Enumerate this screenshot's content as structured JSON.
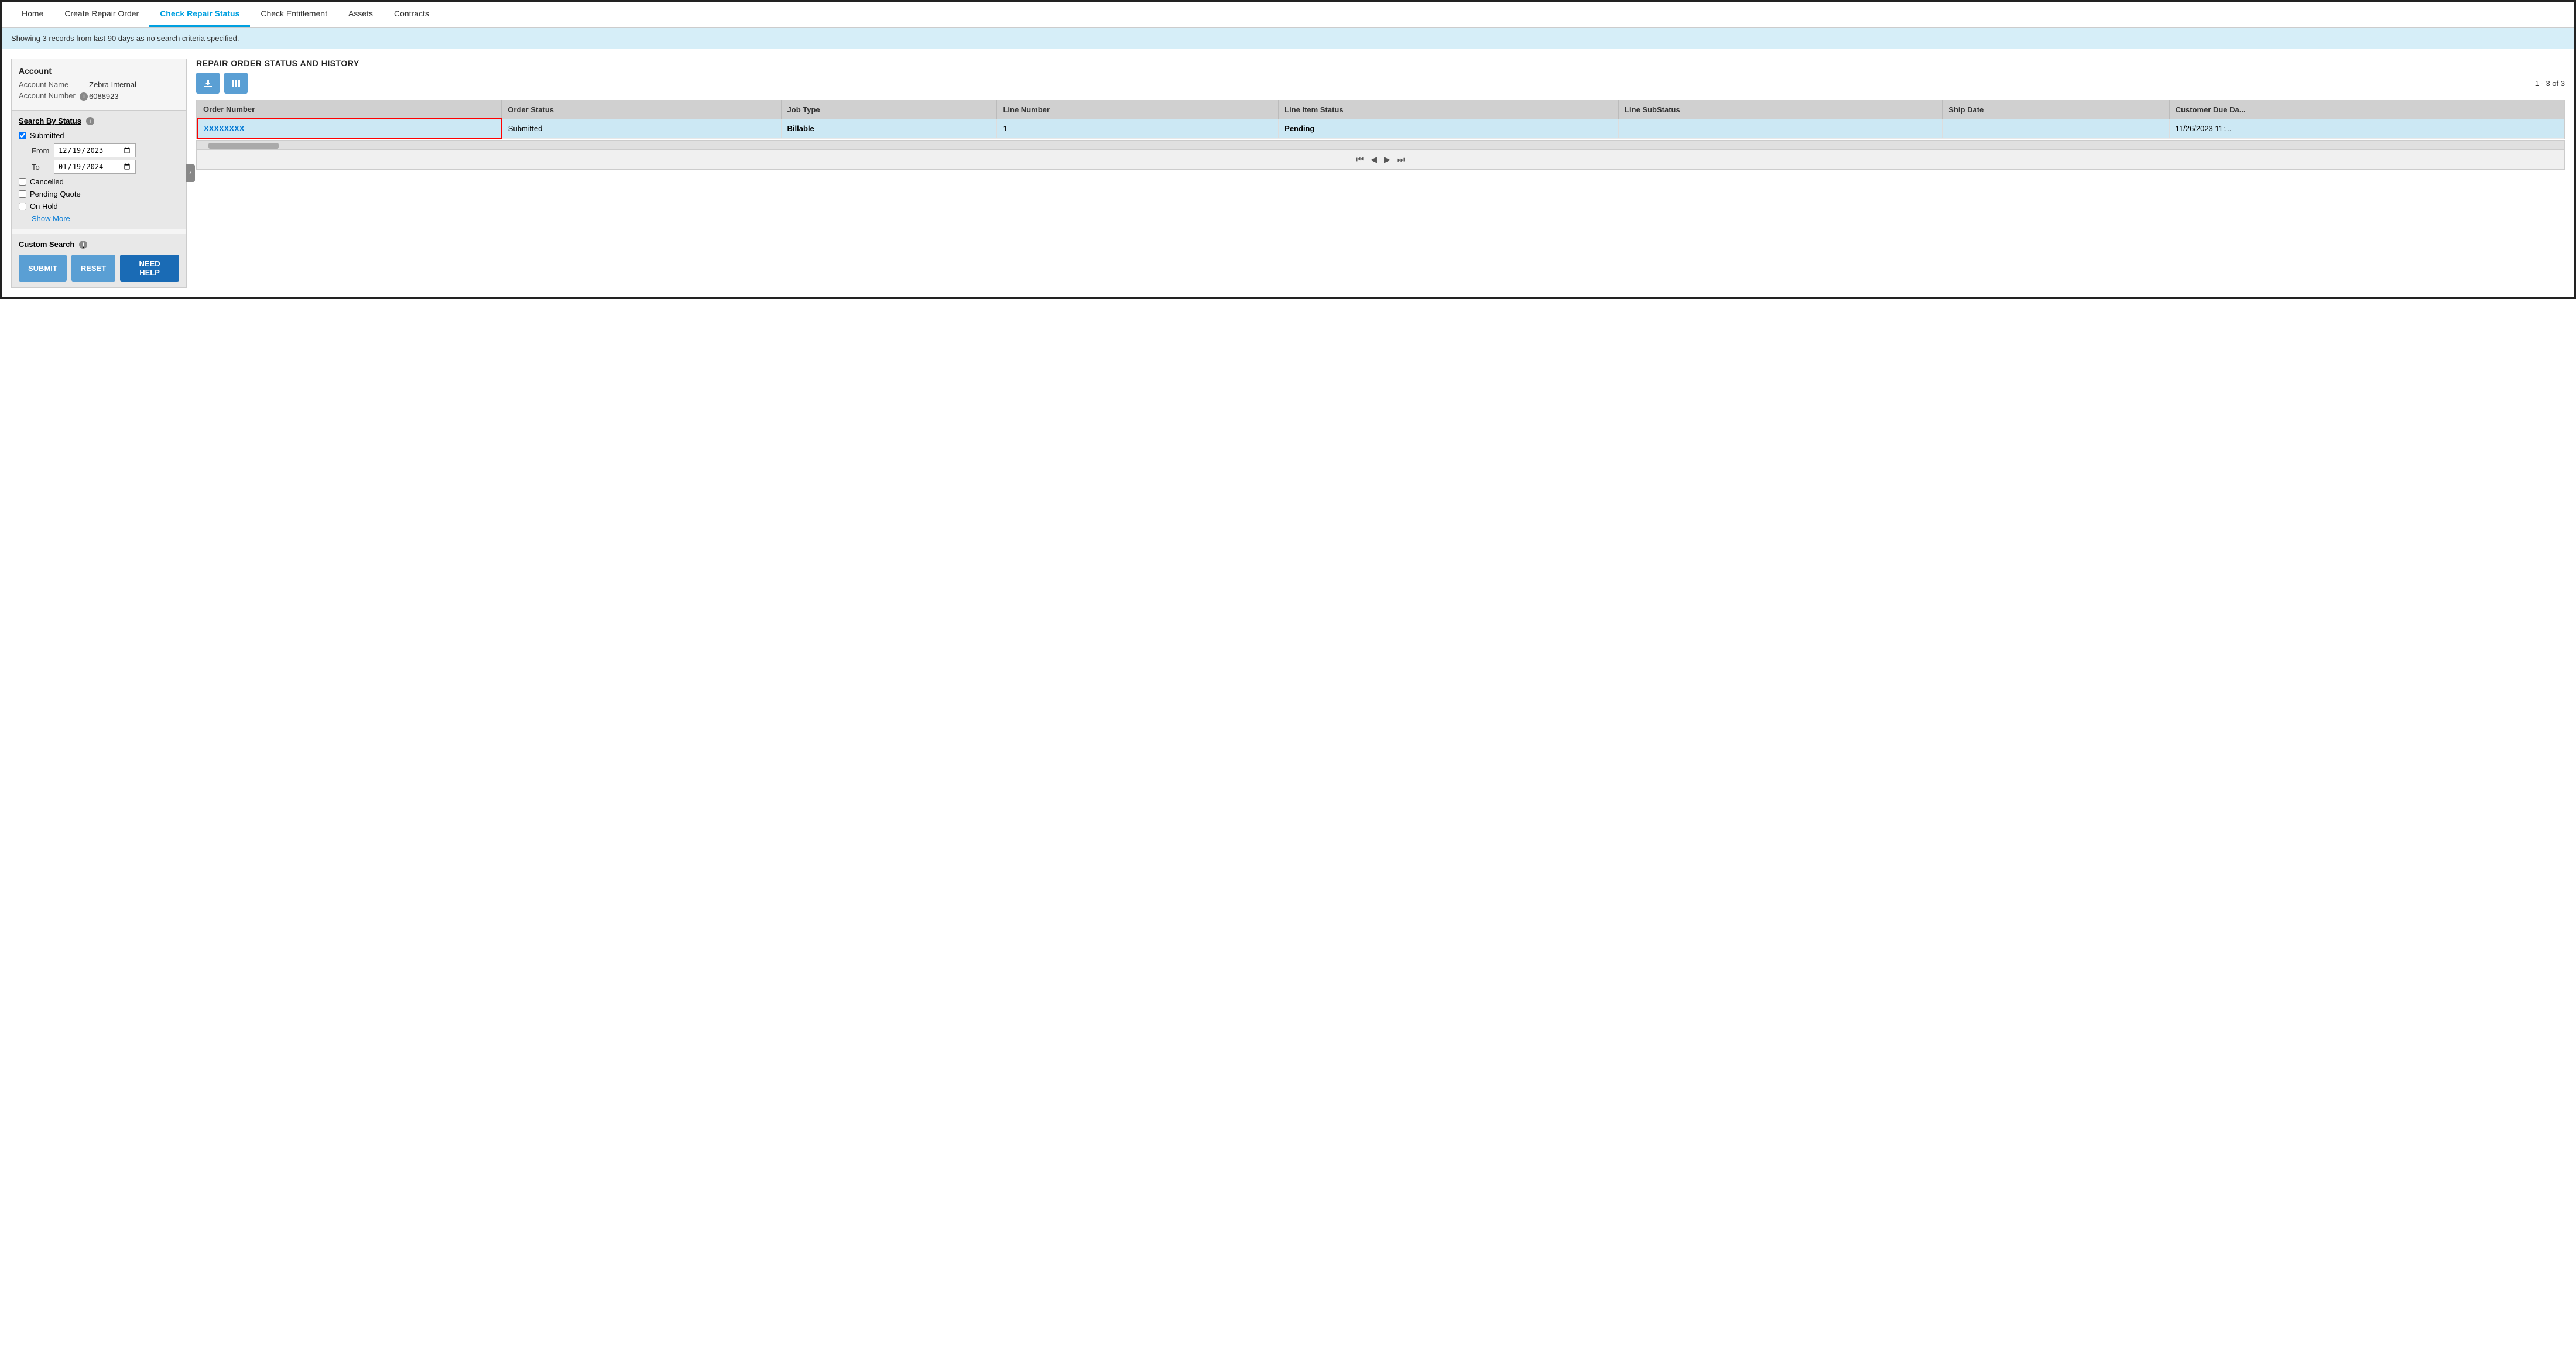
{
  "nav": {
    "tabs": [
      {
        "id": "home",
        "label": "Home",
        "active": false
      },
      {
        "id": "create-repair-order",
        "label": "Create Repair Order",
        "active": false
      },
      {
        "id": "check-repair-status",
        "label": "Check Repair Status",
        "active": true
      },
      {
        "id": "check-entitlement",
        "label": "Check Entitlement",
        "active": false
      },
      {
        "id": "assets",
        "label": "Assets",
        "active": false
      },
      {
        "id": "contracts",
        "label": "Contracts",
        "active": false
      }
    ]
  },
  "infoBanner": {
    "text": "Showing 3 records from last 90 days as no search criteria specified."
  },
  "sectionTitle": "REPAIR ORDER STATUS AND HISTORY",
  "account": {
    "header": "Account",
    "nameLabel": "Account Name",
    "nameValue": "Zebra Internal",
    "numberLabel": "Account Number",
    "numberValue": "6088923"
  },
  "searchByStatus": {
    "header": "Search By Status",
    "checkboxes": [
      {
        "id": "submitted",
        "label": "Submitted",
        "checked": true
      },
      {
        "id": "cancelled",
        "label": "Cancelled",
        "checked": false
      },
      {
        "id": "pending-quote",
        "label": "Pending Quote",
        "checked": false
      },
      {
        "id": "on-hold",
        "label": "On Hold",
        "checked": false
      }
    ],
    "fromLabel": "From",
    "fromValue": "12/19/2023",
    "toLabel": "To",
    "toValue": "01/19/2024",
    "showMoreLabel": "Show More"
  },
  "customSearch": {
    "header": "Custom Search"
  },
  "buttons": {
    "submit": "SUBMIT",
    "reset": "RESET",
    "needHelp": "NEED HELP"
  },
  "toolbar": {
    "downloadTitle": "Download",
    "columnsTitle": "Columns"
  },
  "recordCount": "1 - 3 of 3",
  "table": {
    "columns": [
      "Order Number",
      "Order Status",
      "Job Type",
      "Line Number",
      "Line Item Status",
      "Line SubStatus",
      "Ship Date",
      "Customer Due Da..."
    ],
    "rows": [
      {
        "orderNumber": "XXXXXXXX",
        "orderStatus": "Submitted",
        "jobType": "Billable",
        "lineNumber": "1",
        "lineItemStatus": "Pending",
        "lineSubStatus": "",
        "shipDate": "",
        "customerDueDate": "11/26/2023 11:..."
      }
    ]
  },
  "pagination": {
    "firstLabel": "⏮",
    "prevLabel": "◀",
    "nextLabel": "▶",
    "lastLabel": "⏭"
  }
}
